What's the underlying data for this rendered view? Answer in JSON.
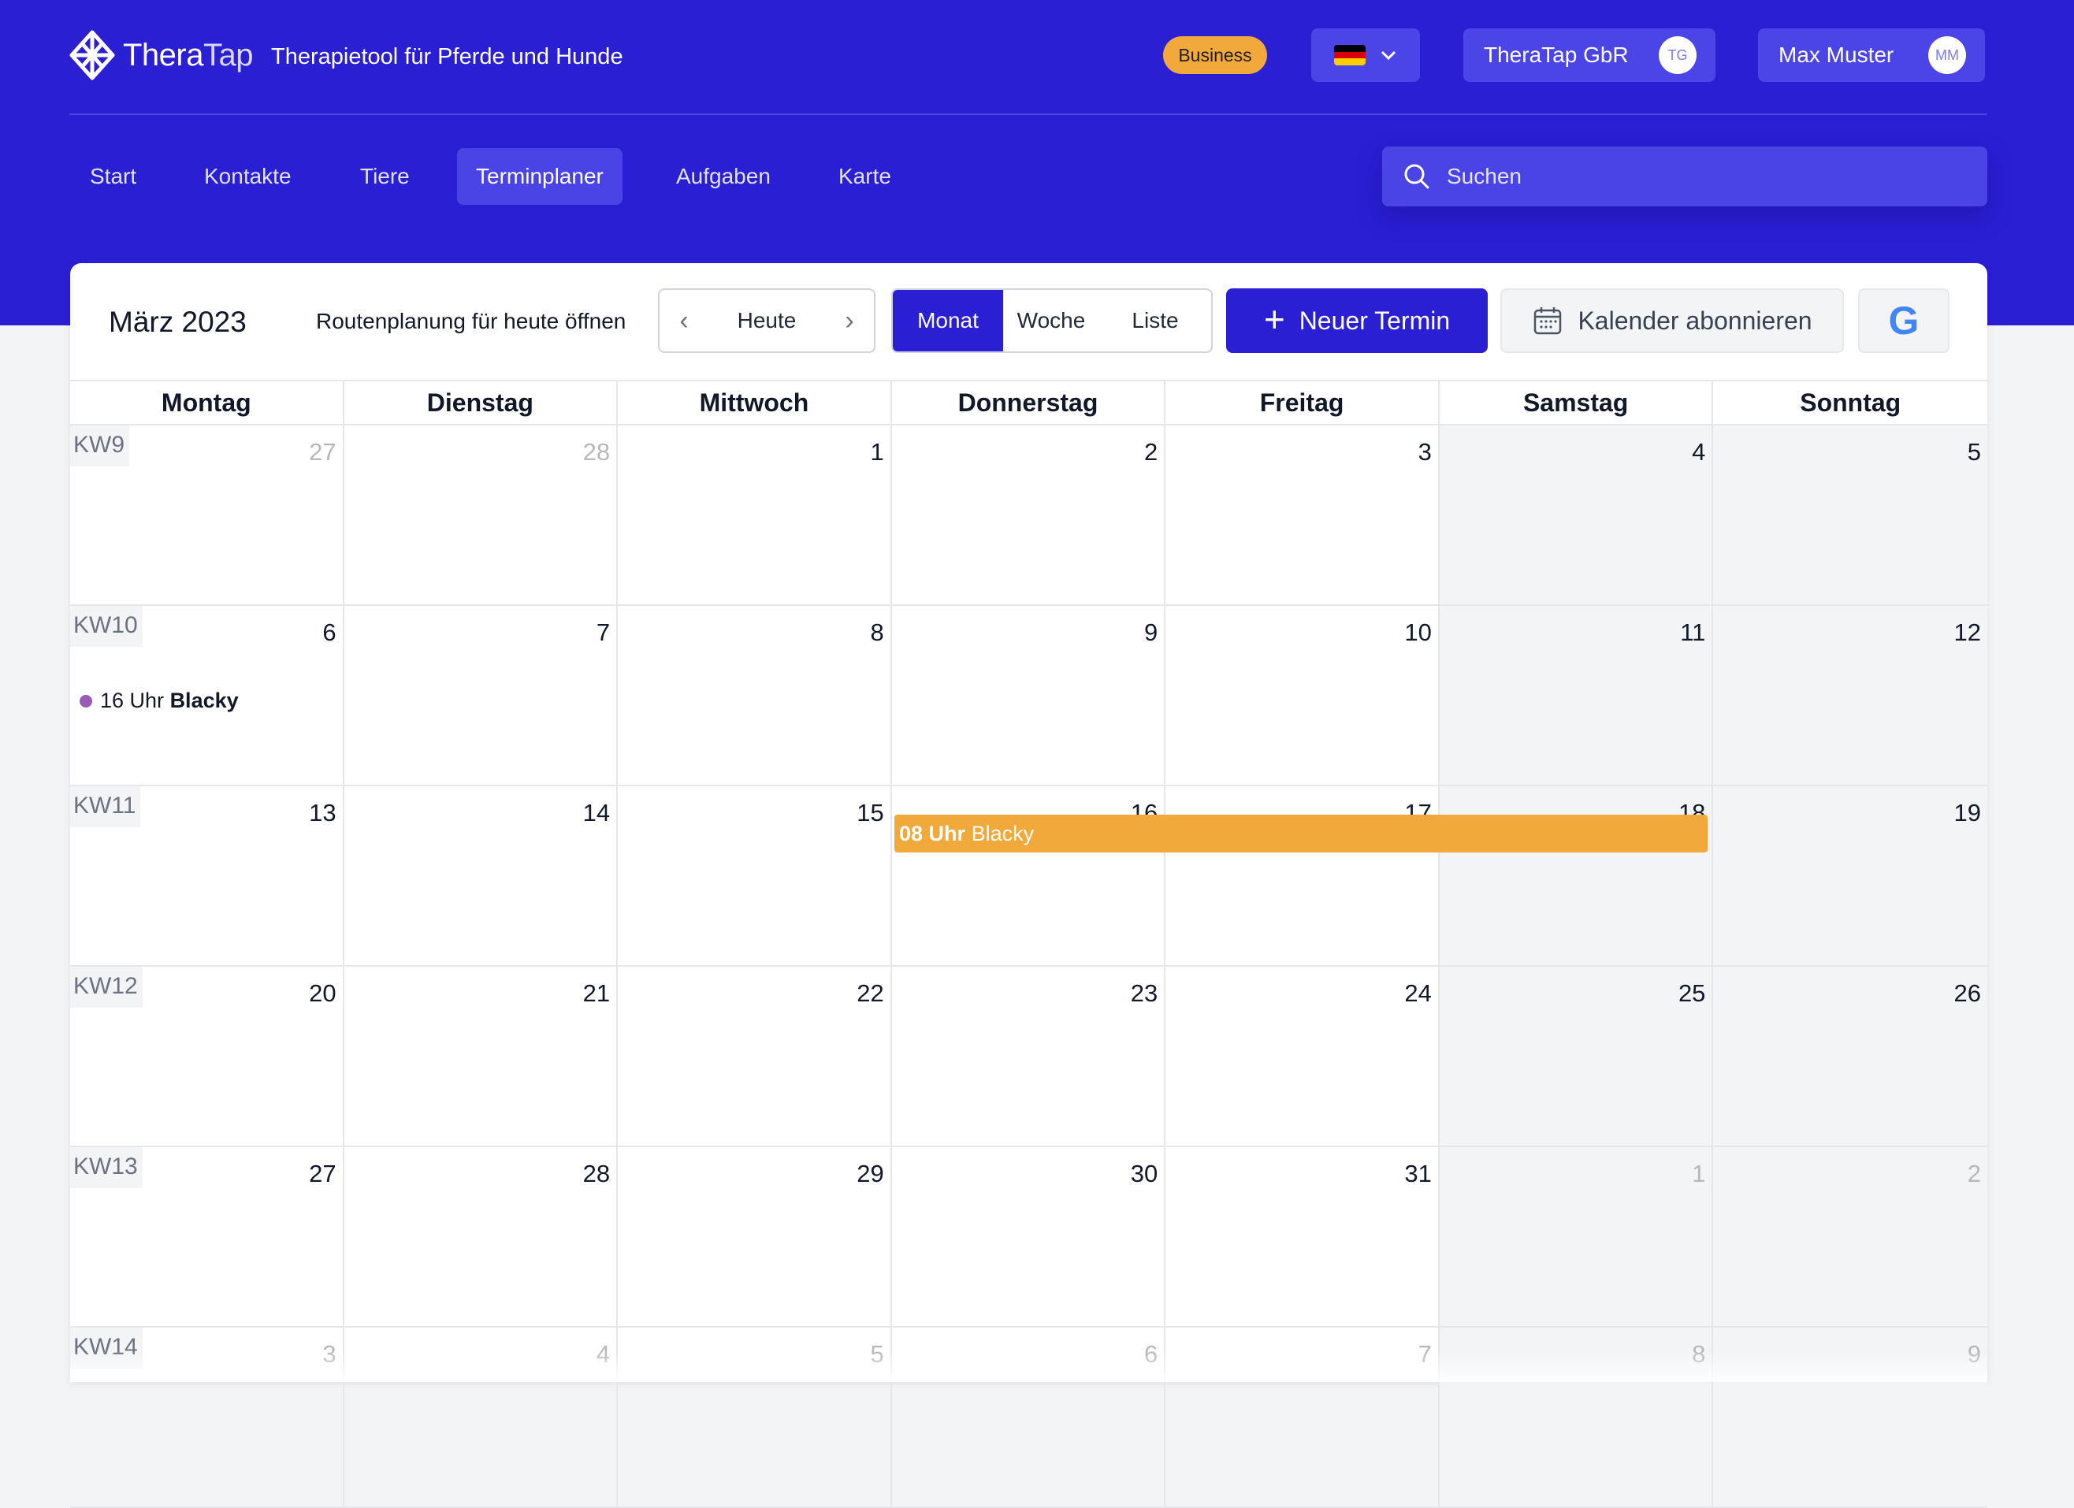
{
  "app": {
    "logo_text_a": "Thera",
    "logo_text_b": "Tap",
    "tagline": "Therapietool für Pferde und Hunde",
    "plan_badge": "Business",
    "company_name": "TheraTap GbR",
    "company_initials": "TG",
    "user_name": "Max Muster",
    "user_initials": "MM",
    "brand_color": "#2a1fd3",
    "accent_color": "#f0a93a"
  },
  "nav": {
    "items": [
      {
        "label": "Start"
      },
      {
        "label": "Kontakte"
      },
      {
        "label": "Tiere"
      },
      {
        "label": "Terminplaner",
        "active": true
      },
      {
        "label": "Aufgaben"
      },
      {
        "label": "Karte"
      }
    ],
    "search_placeholder": "Suchen"
  },
  "calendar": {
    "title": "März 2023",
    "route_link": "Routenplanung für heute öffnen",
    "today_label": "Heute",
    "views": [
      "Monat",
      "Woche",
      "Liste"
    ],
    "active_view": "Monat",
    "new_button": "Neuer Termin",
    "subscribe_button": "Kalender abonnieren",
    "google_letter": "G",
    "weekdays": [
      "Montag",
      "Dienstag",
      "Mittwoch",
      "Donnerstag",
      "Freitag",
      "Samstag",
      "Sonntag"
    ],
    "weeks": [
      {
        "kw": "KW9",
        "days": [
          "27",
          "28",
          "1",
          "2",
          "3",
          "4",
          "5"
        ],
        "other": [
          true,
          true,
          false,
          false,
          false,
          false,
          false
        ]
      },
      {
        "kw": "KW10",
        "days": [
          "6",
          "7",
          "8",
          "9",
          "10",
          "11",
          "12"
        ],
        "other": [
          false,
          false,
          false,
          false,
          false,
          false,
          false
        ]
      },
      {
        "kw": "KW11",
        "days": [
          "13",
          "14",
          "15",
          "16",
          "17",
          "18",
          "19"
        ],
        "other": [
          false,
          false,
          false,
          false,
          false,
          false,
          false
        ]
      },
      {
        "kw": "KW12",
        "days": [
          "20",
          "21",
          "22",
          "23",
          "24",
          "25",
          "26"
        ],
        "other": [
          false,
          false,
          false,
          false,
          false,
          false,
          false
        ]
      },
      {
        "kw": "KW13",
        "days": [
          "27",
          "28",
          "29",
          "30",
          "31",
          "1",
          "2"
        ],
        "other": [
          false,
          false,
          false,
          false,
          false,
          true,
          true
        ]
      },
      {
        "kw": "KW14",
        "days": [
          "3",
          "4",
          "5",
          "6",
          "7",
          "8",
          "9"
        ],
        "other": [
          true,
          true,
          true,
          true,
          true,
          true,
          true
        ]
      }
    ],
    "events": {
      "dot_event": {
        "time": "16 Uhr",
        "name": "Blacky",
        "color": "#9b59b6"
      },
      "bar_event": {
        "time": "08 Uhr",
        "name": "Blacky",
        "color": "#f0a93a"
      }
    }
  }
}
